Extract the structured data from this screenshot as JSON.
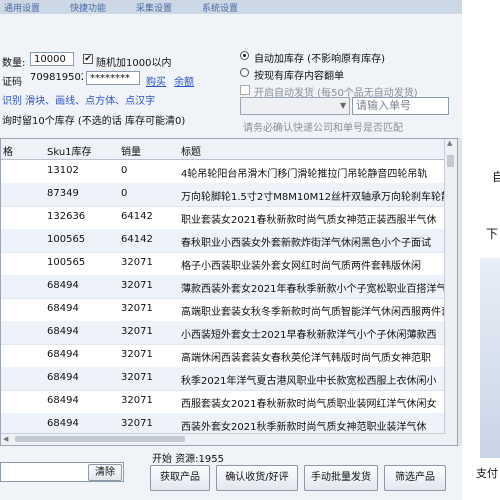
{
  "top_strip": [
    "通用设置",
    "快捷功能",
    "采集设置",
    "系统设置"
  ],
  "settings": {
    "qty_label": "数量:",
    "qty_value": "10000",
    "random_label": "随机加1000以内",
    "verify_label": "证码",
    "verify_code": "709819502",
    "password": "********",
    "buy_link": "购买",
    "refund_link": "余额",
    "options_row": "识别  滑块、画线、点方体、点汉字",
    "keep_note": "询时留10个库存 (不选的话 库存可能清0)",
    "radio_auto_stock": "自动加库存 (不影响原有库存)",
    "radio_copy_stock": "按现有库存内容翻单",
    "auto_ship_label": "开启自动发货 (每50个品无自动发货)",
    "order_placeholder": "请输入单号",
    "confirm_note": "请务必确认快递公司和单号是否匹配"
  },
  "table": {
    "columns": [
      "格",
      "Sku1库存",
      "销量",
      "标题"
    ],
    "rows": [
      [
        "",
        "13102",
        "0",
        "4轮吊轮阳台吊滑木门移门滑轮推拉门吊轮静音四轮吊轨"
      ],
      [
        "",
        "87349",
        "0",
        "万向轮脚轮1.5寸2寸M8M10M12丝杆双轴承万向轮刹车轮静"
      ],
      [
        "",
        "132636",
        "64142",
        "职业套装女2021春秋新款时尚气质女神范正装西服半气休"
      ],
      [
        "",
        "100565",
        "64142",
        "春秋职业小西装女外套新款炸街洋气休闲黑色小个子面试"
      ],
      [
        "",
        "100565",
        "32071",
        "格子小西装职业装外套女网红时尚气质两件套韩版休闲"
      ],
      [
        "",
        "68494",
        "32071",
        "薄款西装外套女2021年春秋季新款小个子宽松职业百搭洋气通勤休"
      ],
      [
        "",
        "68494",
        "32071",
        "高端职业套装女秋冬季新款时尚气质智能洋气休闲西服两件套职"
      ],
      [
        "",
        "68494",
        "32071",
        "小西装短外套女士2021早春秋新款洋气小个子休闲薄款西"
      ],
      [
        "",
        "68494",
        "32071",
        "高端休闲西装套装女春秋英伦洋气韩版时尚气质女神范职"
      ],
      [
        "",
        "68494",
        "32071",
        "秋季2021年洋气夏古港风职业中长款宽松西服上衣休闲小"
      ],
      [
        "",
        "68494",
        "32071",
        "西服套装女2021春秋新款时尚气质职业装网红洋气休闲女"
      ],
      [
        "",
        "68494",
        "32071",
        "西装外套女2021秋季新款时尚气质女神范职业装洋气休"
      ]
    ]
  },
  "bottom": {
    "clear_btn": "清除",
    "status": "开始 资源:1955",
    "fetch_btn": "获取产品",
    "confirm_btn": "确认收货/好评",
    "batch_ship_btn": "手动批量发货",
    "filter_btn": "筛选产品"
  },
  "right_panel": [
    "自",
    "下",
    "支付"
  ]
}
